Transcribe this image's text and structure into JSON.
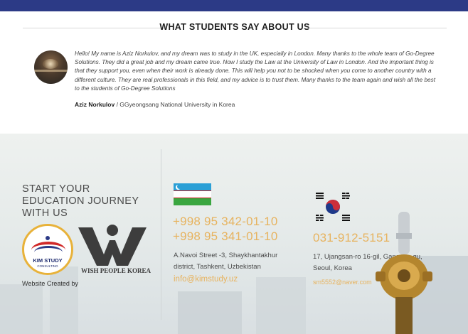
{
  "testimonials": {
    "heading": "WHAT STUDENTS SAY ABOUT US",
    "items": [
      {
        "quote": "Hello! My name is Aziz Norkulov, and my dream was to study in the UK, especially in London. Many thanks to the whole team of Go-Degree Solutions. They did a great job and my dream came true. Now I study the Law at the University of Law in London. And the important thing is that they support you, even when their work is already done. This will help you not to be shocked when you come to another country with a different culture. They are real professionals in this field, and my advice is to trust them. Many thanks to the team again and wish all the best to the students of Go-Degree Solutions",
        "author_name": "Aziz Norkulov",
        "author_affiliation": " / GGyeongsang National University in Korea"
      }
    ]
  },
  "footer": {
    "start_lines": [
      "START YOUR",
      "EDUCATION JOURNEY",
      "WITH US"
    ],
    "kim_logo": {
      "title": "KIM STUDY",
      "subtitle": "CONSULTING"
    },
    "wish_logo": {
      "text": "WISH PEOPLE KOREA"
    },
    "created_label": "Website Created by",
    "uzbekistan": {
      "phones": [
        "+998 95 342-01-10",
        "+998 95 341-01-10"
      ],
      "address": "A.Navoi Street -3, Shaykhantakhur district, Tashkent, Uzbekistan",
      "email": "info@kimstudy.uz"
    },
    "korea": {
      "phone": "031-912-5151",
      "address": "17, Ujangsan-ro 16-gil, Gangseo-gu, Seoul, Korea",
      "email": "sm5552@naver.com"
    }
  },
  "colors": {
    "top_bar": "#2c3a86",
    "accent": "#e7b35f"
  },
  "icons": [
    "uzbekistan-flag-icon",
    "south-korea-flag-icon"
  ]
}
